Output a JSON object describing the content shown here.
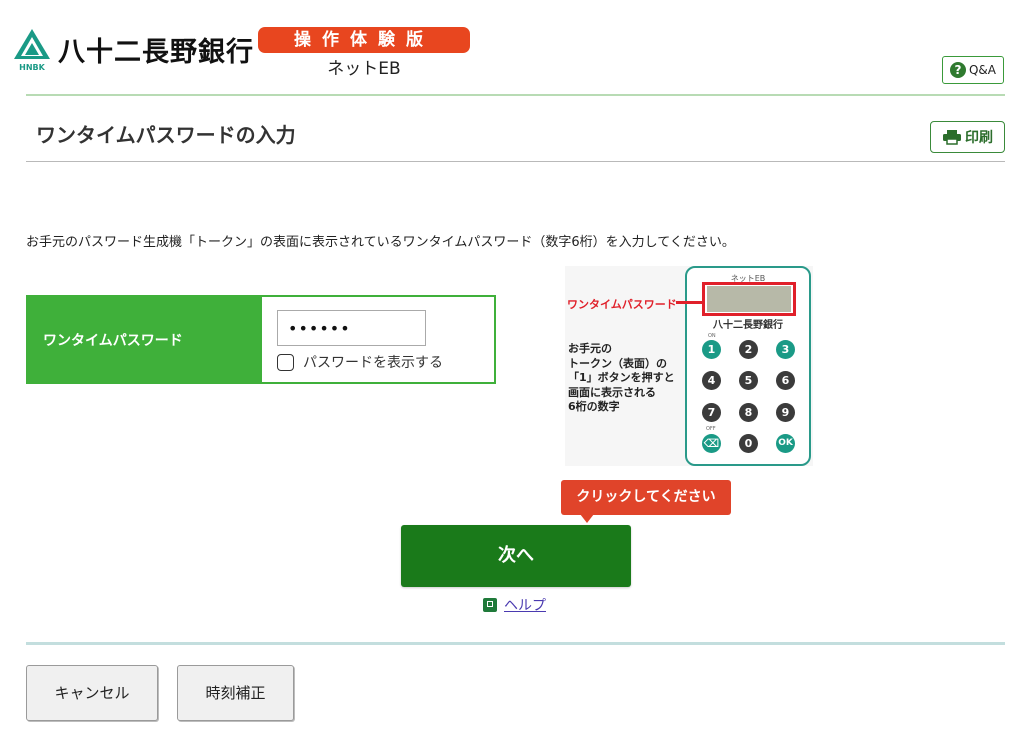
{
  "header": {
    "bank_name": "八十二長野銀行",
    "logo_caption": "HNBK",
    "demo_badge": "操作体験版",
    "product_name": "ネットEB",
    "qa_button": "Q&A"
  },
  "page": {
    "title": "ワンタイムパスワードの入力",
    "print_button": "印刷",
    "instruction": "お手元のパスワード生成機「トークン」の表面に表示されているワンタイムパスワード（数字6桁）を入力してください。"
  },
  "form": {
    "label": "ワンタイムパスワード",
    "otp_value": "••••••",
    "show_password_label": "パスワードを表示する",
    "show_password_checked": false
  },
  "token_illustration": {
    "brand": "ネットEB",
    "otp_label": "ワンタイムパスワード",
    "bank_name": "八十二長野銀行",
    "description_lines": [
      "お手元の",
      "トークン（表面）の",
      "「1」ボタンを押すと",
      "画面に表示される",
      "6桁の数字"
    ],
    "key_on_caption": "ON",
    "key_off_caption": "OFF",
    "keys": [
      "1",
      "2",
      "3",
      "4",
      "5",
      "6",
      "7",
      "8",
      "9",
      "⌫",
      "0",
      "OK"
    ]
  },
  "actions": {
    "callout": "クリックしてください",
    "next_button": "次へ",
    "help_link": "ヘルプ",
    "cancel_button": "キャンセル",
    "time_adjust_button": "時刻補正"
  },
  "colors": {
    "brand_green": "#3fb03a",
    "next_green": "#1a7a1a",
    "badge_red": "#e8461f",
    "token_teal": "#1a9a86"
  }
}
